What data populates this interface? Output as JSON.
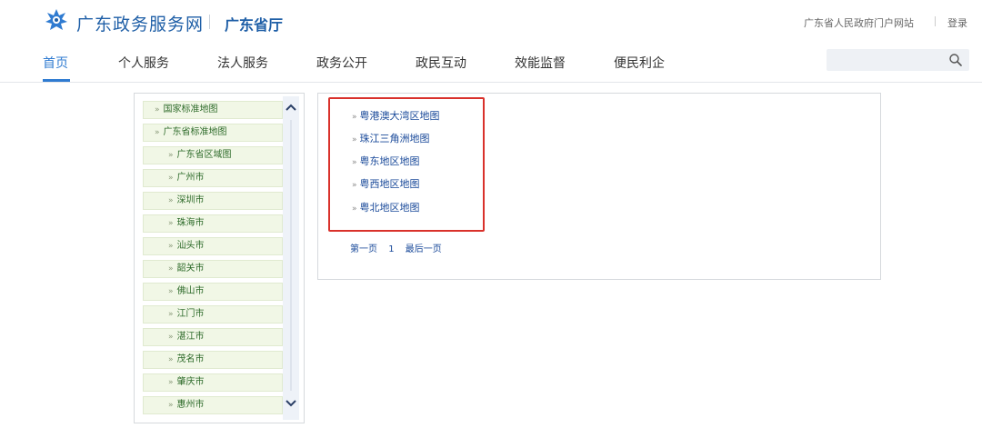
{
  "header": {
    "site_title": "广东政务服务网",
    "department": "广东省厅",
    "portal_link": "广东省人民政府门户网站",
    "login": "登录"
  },
  "nav": {
    "items": [
      "首页",
      "个人服务",
      "法人服务",
      "政务公开",
      "政民互动",
      "效能监督",
      "便民利企"
    ],
    "active": "首页",
    "search_placeholder": ""
  },
  "tree": {
    "items": [
      {
        "label": "国家标准地图",
        "level": 0
      },
      {
        "label": "广东省标准地图",
        "level": 0
      },
      {
        "label": "广东省区域图",
        "level": 1
      },
      {
        "label": "广州市",
        "level": 1
      },
      {
        "label": "深圳市",
        "level": 1
      },
      {
        "label": "珠海市",
        "level": 1
      },
      {
        "label": "汕头市",
        "level": 1
      },
      {
        "label": "韶关市",
        "level": 1
      },
      {
        "label": "佛山市",
        "level": 1
      },
      {
        "label": "江门市",
        "level": 1
      },
      {
        "label": "湛江市",
        "level": 1
      },
      {
        "label": "茂名市",
        "level": 1
      },
      {
        "label": "肇庆市",
        "level": 1
      },
      {
        "label": "惠州市",
        "level": 1
      }
    ]
  },
  "map_list": {
    "items": [
      "粤港澳大湾区地图",
      "珠江三角洲地图",
      "粤东地区地图",
      "粤西地区地图",
      "粤北地区地图"
    ]
  },
  "pager": {
    "first": "第一页",
    "current": "1",
    "last": "最后一页"
  },
  "colors": {
    "brand": "#1f5fa7",
    "nav_active": "#2f7bd1",
    "highlight": "#d9312b",
    "tree_bg": "#f1f7e6"
  },
  "chevron": "»"
}
